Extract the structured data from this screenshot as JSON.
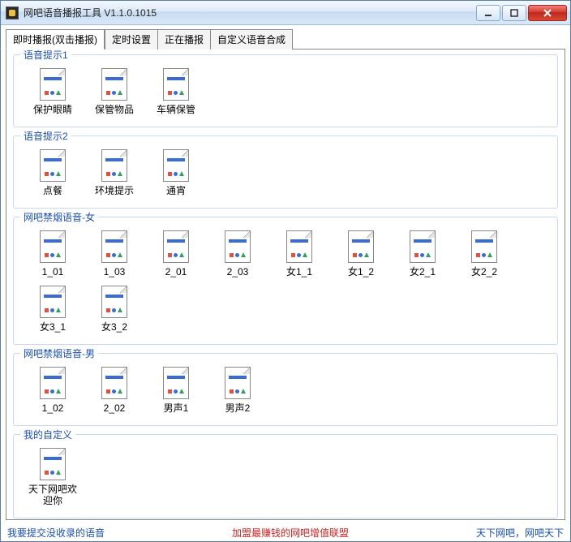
{
  "window": {
    "title": "网吧语音播报工具 V1.1.0.1015"
  },
  "tabs": [
    {
      "label": "即时播报(双击播报)",
      "active": true
    },
    {
      "label": "定时设置",
      "active": false
    },
    {
      "label": "正在播报",
      "active": false
    },
    {
      "label": "自定义语音合成",
      "active": false
    }
  ],
  "groups": [
    {
      "title": "语音提示1",
      "items": [
        {
          "label": "保护眼睛"
        },
        {
          "label": "保管物品"
        },
        {
          "label": "车辆保管"
        }
      ]
    },
    {
      "title": "语音提示2",
      "items": [
        {
          "label": "点餐"
        },
        {
          "label": "环境提示"
        },
        {
          "label": "通宵"
        }
      ]
    },
    {
      "title": "网吧禁烟语音-女",
      "items": [
        {
          "label": "1_01"
        },
        {
          "label": "1_03"
        },
        {
          "label": "2_01"
        },
        {
          "label": "2_03"
        },
        {
          "label": "女1_1"
        },
        {
          "label": "女1_2"
        },
        {
          "label": "女2_1"
        },
        {
          "label": "女2_2"
        },
        {
          "label": "女3_1"
        },
        {
          "label": "女3_2"
        }
      ]
    },
    {
      "title": "网吧禁烟语音-男",
      "items": [
        {
          "label": "1_02"
        },
        {
          "label": "2_02"
        },
        {
          "label": "男声1"
        },
        {
          "label": "男声2"
        }
      ]
    },
    {
      "title": "我的自定义",
      "items": [
        {
          "label": "天下网吧欢迎你"
        }
      ]
    }
  ],
  "status": {
    "left": "我要提交没收录的语音",
    "center": "加盟最赚钱的网吧增值联盟",
    "right": "天下网吧，网吧天下"
  }
}
